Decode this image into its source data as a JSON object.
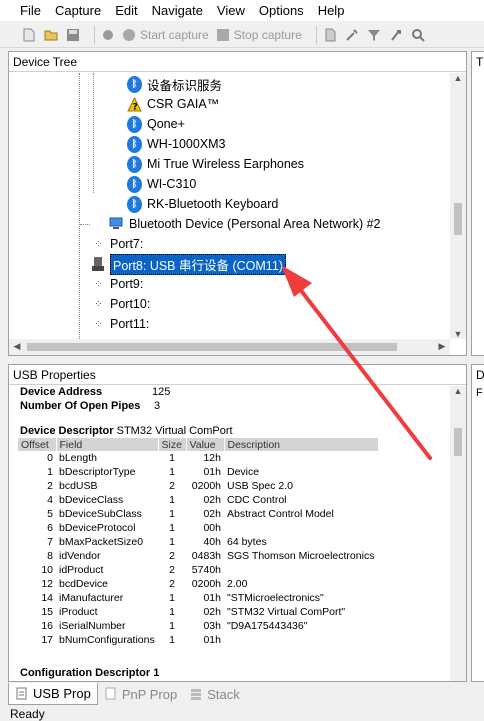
{
  "menu": [
    "File",
    "Capture",
    "Edit",
    "Navigate",
    "View",
    "Options",
    "Help"
  ],
  "toolbar": {
    "start_capture": "Start capture",
    "stop_capture": "Stop capture"
  },
  "device_tree": {
    "title": "Device Tree",
    "nodes": [
      {
        "label": "设备标识服务",
        "icon": "bluetooth-icon"
      },
      {
        "label": "CSR GAIA™",
        "icon": "warning-icon"
      },
      {
        "label": "Qone+",
        "icon": "bluetooth-icon"
      },
      {
        "label": "WH-1000XM3",
        "icon": "bluetooth-icon"
      },
      {
        "label": "Mi True Wireless Earphones",
        "icon": "bluetooth-icon"
      },
      {
        "label": "WI-C310",
        "icon": "bluetooth-icon"
      },
      {
        "label": "RK-Bluetooth Keyboard",
        "icon": "bluetooth-icon"
      },
      {
        "label": "Bluetooth Device (Personal Area Network) #2",
        "icon": "network-icon"
      },
      {
        "label": "Port7:",
        "icon": "port-icon"
      },
      {
        "label": "Port8: USB 串行设备 (COM11)",
        "icon": "usb-device-icon"
      },
      {
        "label": "Port9:",
        "icon": "port-icon"
      },
      {
        "label": "Port10:",
        "icon": "port-icon"
      },
      {
        "label": "Port11:",
        "icon": "port-icon"
      }
    ]
  },
  "right_panel_top": {
    "title": "T"
  },
  "right_panel_bottom": {
    "title": "D",
    "text": "F"
  },
  "usb_properties": {
    "title": "USB Properties",
    "device_address_label": "Device Address",
    "device_address_value": "125",
    "open_pipes_label": "Number Of Open Pipes",
    "open_pipes_value": "3",
    "device_descriptor_label": "Device Descriptor",
    "device_descriptor_value": "STM32 Virtual ComPort",
    "columns": [
      "Offset",
      "Field",
      "Size",
      "Value",
      "Description"
    ],
    "rows": [
      [
        "0",
        "bLength",
        "1",
        "12h",
        ""
      ],
      [
        "1",
        "bDescriptorType",
        "1",
        "01h",
        "Device"
      ],
      [
        "2",
        "bcdUSB",
        "2",
        "0200h",
        "USB Spec 2.0"
      ],
      [
        "4",
        "bDeviceClass",
        "1",
        "02h",
        "CDC Control"
      ],
      [
        "5",
        "bDeviceSubClass",
        "1",
        "02h",
        "Abstract Control Model"
      ],
      [
        "6",
        "bDeviceProtocol",
        "1",
        "00h",
        ""
      ],
      [
        "7",
        "bMaxPacketSize0",
        "1",
        "40h",
        "64 bytes"
      ],
      [
        "8",
        "idVendor",
        "2",
        "0483h",
        "SGS Thomson Microelectronics"
      ],
      [
        "10",
        "idProduct",
        "2",
        "5740h",
        ""
      ],
      [
        "12",
        "bcdDevice",
        "2",
        "0200h",
        "2.00"
      ],
      [
        "14",
        "iManufacturer",
        "1",
        "01h",
        "\"STMicroelectronics\""
      ],
      [
        "15",
        "iProduct",
        "1",
        "02h",
        "\"STM32 Virtual ComPort\""
      ],
      [
        "16",
        "iSerialNumber",
        "1",
        "03h",
        "\"D9A175443436\""
      ],
      [
        "17",
        "bNumConfigurations",
        "1",
        "01h",
        ""
      ]
    ],
    "config_descriptor_label": "Configuration Descriptor 1"
  },
  "tabs": [
    "USB Prop",
    "PnP Prop",
    "Stack"
  ],
  "status": "Ready",
  "colors": {
    "selection": "#0a64c8",
    "bluetooth": "#1e7ae0",
    "arrow": "#f03c3c"
  }
}
